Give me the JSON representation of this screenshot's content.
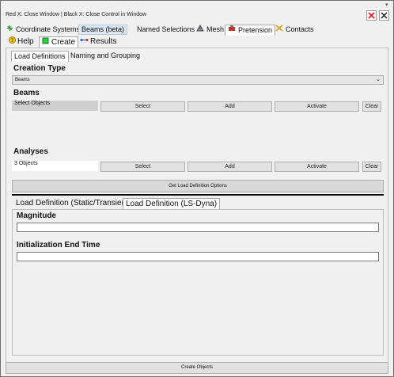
{
  "window": {
    "title": "Red X: Close Window | Black X: Close Control in Window",
    "pin_symbol": "▾"
  },
  "main_tabs": [
    {
      "label": "Coordinate Systems",
      "icon": "coordinate-systems-icon"
    },
    {
      "label": "Beams (beta)"
    },
    {
      "label": "Named Selections"
    },
    {
      "label": "Mesh",
      "icon": "mesh-icon"
    },
    {
      "label": "Pretension",
      "icon": "pretension-icon"
    },
    {
      "label": "Contacts",
      "icon": "contacts-icon"
    }
  ],
  "sub_tabs": [
    {
      "label": "Help",
      "icon": "help-icon"
    },
    {
      "label": "Create",
      "icon": "create-icon"
    },
    {
      "label": "Results",
      "icon": "results-icon"
    }
  ],
  "panel_tabs": [
    {
      "label": "Load Definitions"
    },
    {
      "label": "Naming and Grouping"
    }
  ],
  "creation_type": {
    "heading": "Creation Type",
    "selected": "Beams"
  },
  "beams": {
    "heading": "Beams",
    "selection_text": "Select Objects",
    "select_label": "Select",
    "add_label": "Add",
    "activate_label": "Activate",
    "clear_label": "Clear"
  },
  "analyses": {
    "heading": "Analyses",
    "selection_text": "3 Objects",
    "select_label": "Select",
    "add_label": "Add",
    "activate_label": "Activate",
    "clear_label": "Clear"
  },
  "get_options_label": "Get Load Definition Options",
  "load_tabs": [
    {
      "label": "Load Definition (Static/Transient)"
    },
    {
      "label": "Load Definition (LS-Dyna)"
    }
  ],
  "magnitude": {
    "heading": "Magnitude",
    "value": ""
  },
  "init_end_time": {
    "heading": "Initialization End Time",
    "value": ""
  },
  "create_objects_label": "Create Objects",
  "colors": {
    "close_red": "#e81123",
    "selected_tab": "#dbe6f3",
    "panel_bg": "#f0f0f0"
  }
}
